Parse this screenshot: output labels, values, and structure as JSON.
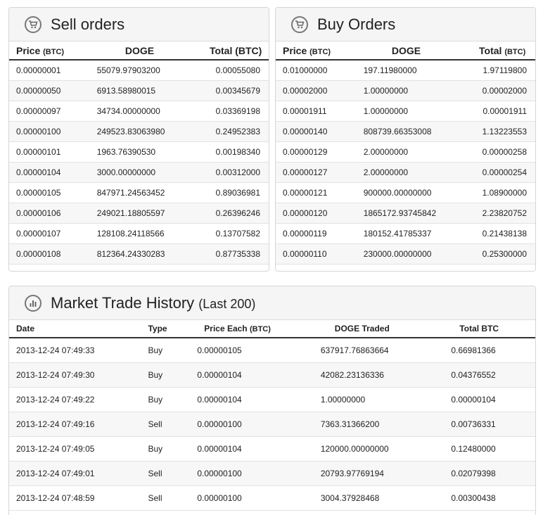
{
  "sell": {
    "title": "Sell orders",
    "headers": {
      "price": "Price",
      "price_unit": "(BTC)",
      "doge": "DOGE",
      "total": "Total (BTC)"
    },
    "rows": [
      {
        "price": "0.00000001",
        "doge": "55079.97903200",
        "total": "0.00055080"
      },
      {
        "price": "0.00000050",
        "doge": "6913.58980015",
        "total": "0.00345679"
      },
      {
        "price": "0.00000097",
        "doge": "34734.00000000",
        "total": "0.03369198"
      },
      {
        "price": "0.00000100",
        "doge": "249523.83063980",
        "total": "0.24952383"
      },
      {
        "price": "0.00000101",
        "doge": "1963.76390530",
        "total": "0.00198340"
      },
      {
        "price": "0.00000104",
        "doge": "3000.00000000",
        "total": "0.00312000"
      },
      {
        "price": "0.00000105",
        "doge": "847971.24563452",
        "total": "0.89036981"
      },
      {
        "price": "0.00000106",
        "doge": "249021.18805597",
        "total": "0.26396246"
      },
      {
        "price": "0.00000107",
        "doge": "128108.24118566",
        "total": "0.13707582"
      },
      {
        "price": "0.00000108",
        "doge": "812364.24330283",
        "total": "0.87735338"
      }
    ]
  },
  "buy": {
    "title": "Buy Orders",
    "headers": {
      "price": "Price",
      "price_unit": "(BTC)",
      "doge": "DOGE",
      "total": "Total",
      "total_unit": "(BTC)"
    },
    "rows": [
      {
        "price": "0.01000000",
        "doge": "197.11980000",
        "total": "1.97119800"
      },
      {
        "price": "0.00002000",
        "doge": "1.00000000",
        "total": "0.00002000"
      },
      {
        "price": "0.00001911",
        "doge": "1.00000000",
        "total": "0.00001911"
      },
      {
        "price": "0.00000140",
        "doge": "808739.66353008",
        "total": "1.13223553"
      },
      {
        "price": "0.00000129",
        "doge": "2.00000000",
        "total": "0.00000258"
      },
      {
        "price": "0.00000127",
        "doge": "2.00000000",
        "total": "0.00000254"
      },
      {
        "price": "0.00000121",
        "doge": "900000.00000000",
        "total": "1.08900000"
      },
      {
        "price": "0.00000120",
        "doge": "1865172.93745842",
        "total": "2.23820752"
      },
      {
        "price": "0.00000119",
        "doge": "180152.41785337",
        "total": "0.21438138"
      },
      {
        "price": "0.00000110",
        "doge": "230000.00000000",
        "total": "0.25300000"
      }
    ]
  },
  "history": {
    "title": "Market Trade History",
    "subtitle": "(Last 200)",
    "headers": {
      "date": "Date",
      "type": "Type",
      "price": "Price Each",
      "price_unit": "(BTC)",
      "doge": "DOGE Traded",
      "total": "Total BTC"
    },
    "rows": [
      {
        "date": "2013-12-24 07:49:33",
        "type": "Buy",
        "price": "0.00000105",
        "doge": "637917.76863664",
        "total": "0.66981366"
      },
      {
        "date": "2013-12-24 07:49:30",
        "type": "Buy",
        "price": "0.00000104",
        "doge": "42082.23136336",
        "total": "0.04376552"
      },
      {
        "date": "2013-12-24 07:49:22",
        "type": "Buy",
        "price": "0.00000104",
        "doge": "1.00000000",
        "total": "0.00000104"
      },
      {
        "date": "2013-12-24 07:49:16",
        "type": "Sell",
        "price": "0.00000100",
        "doge": "7363.31366200",
        "total": "0.00736331"
      },
      {
        "date": "2013-12-24 07:49:05",
        "type": "Buy",
        "price": "0.00000104",
        "doge": "120000.00000000",
        "total": "0.12480000"
      },
      {
        "date": "2013-12-24 07:49:01",
        "type": "Sell",
        "price": "0.00000100",
        "doge": "20793.97769194",
        "total": "0.02079398"
      },
      {
        "date": "2013-12-24 07:48:59",
        "type": "Sell",
        "price": "0.00000100",
        "doge": "3004.37928468",
        "total": "0.00300438"
      }
    ]
  },
  "icons": {
    "sell": "cart-icon",
    "buy": "cart-icon",
    "history": "bar-chart-icon"
  }
}
